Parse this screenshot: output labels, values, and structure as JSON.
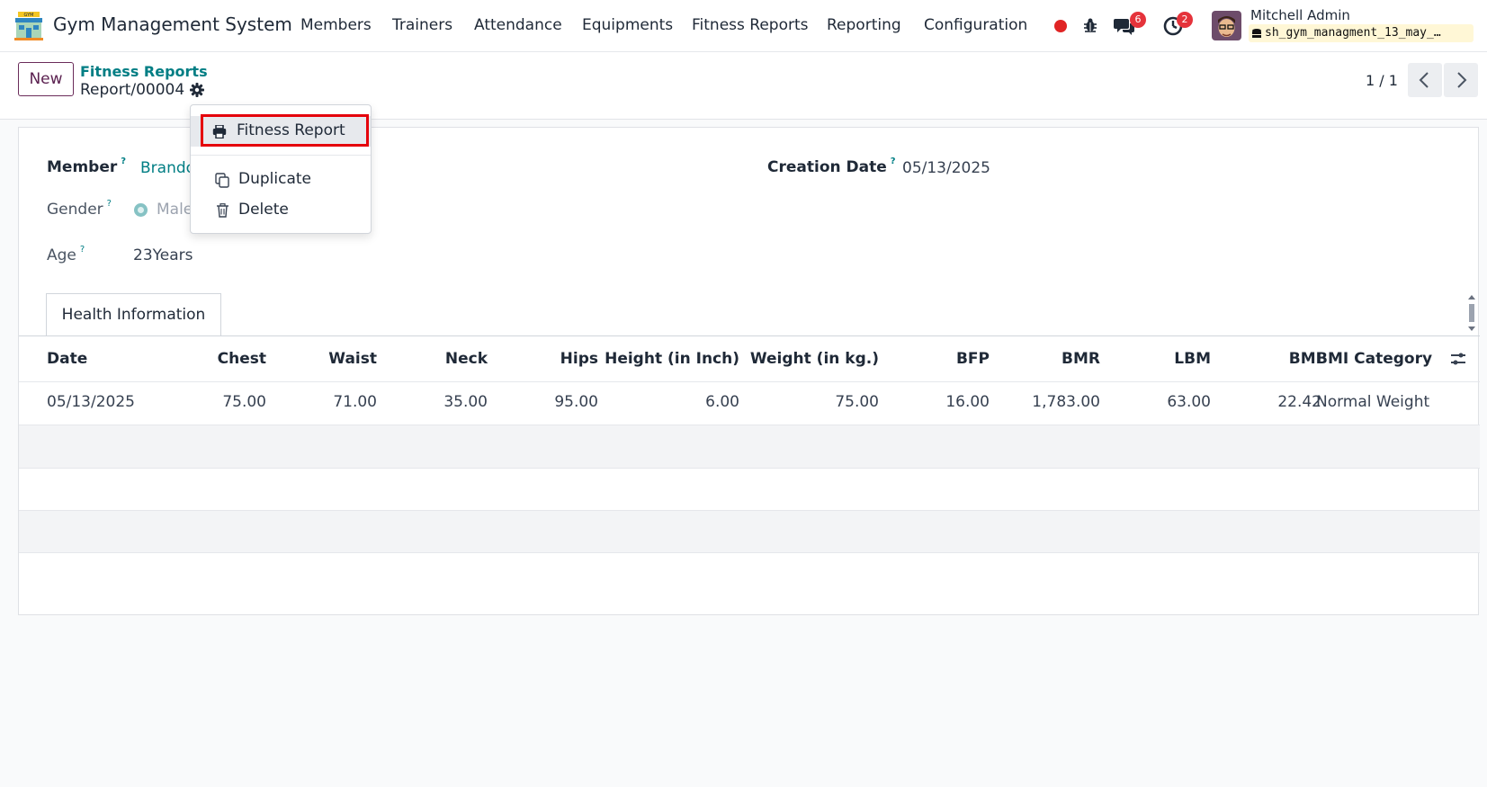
{
  "app": {
    "title": "Gym Management System",
    "menu": [
      "Members",
      "Trainers",
      "Attendance",
      "Equipments",
      "Fitness Reports",
      "Reporting",
      "Configuration"
    ]
  },
  "systray": {
    "record_icon": "red-dot-icon",
    "debug_icon": "bug-icon",
    "messages_badge": "6",
    "activities_badge": "2",
    "user_name": "Mitchell Admin",
    "database": "sh_gym_managment_13_may_…"
  },
  "control_panel": {
    "new_label": "New",
    "breadcrumb_parent": "Fitness Reports",
    "breadcrumb_current": "Report/00004",
    "pager": "1 / 1"
  },
  "dropdown": {
    "items": [
      {
        "label": "Fitness Report",
        "icon": "print-icon"
      },
      {
        "label": "Duplicate",
        "icon": "copy-icon"
      },
      {
        "label": "Delete",
        "icon": "trash-icon"
      }
    ]
  },
  "form": {
    "member_label": "Member",
    "member_value": "Brando",
    "gender_label": "Gender",
    "gender_value": "Male",
    "age_label": "Age",
    "age_value": "23Years",
    "creation_date_label": "Creation Date",
    "creation_date_value": "05/13/2025",
    "help_mark": "?"
  },
  "tabs": {
    "health_info": "Health Information"
  },
  "table": {
    "columns": [
      "Date",
      "Chest",
      "Waist",
      "Neck",
      "Hips",
      "Height (in Inch)",
      "Weight (in kg.)",
      "BFP",
      "BMR",
      "LBM",
      "BMI",
      "BMI Category"
    ],
    "rows": [
      [
        "05/13/2025",
        "75.00",
        "71.00",
        "35.00",
        "95.00",
        "6.00",
        "75.00",
        "16.00",
        "1,783.00",
        "63.00",
        "22.42",
        "Normal Weight"
      ]
    ]
  },
  "colors": {
    "brand": "#714b67",
    "link": "#017e84",
    "badge": "#e5333b",
    "highlight_border": "#e5000b"
  }
}
